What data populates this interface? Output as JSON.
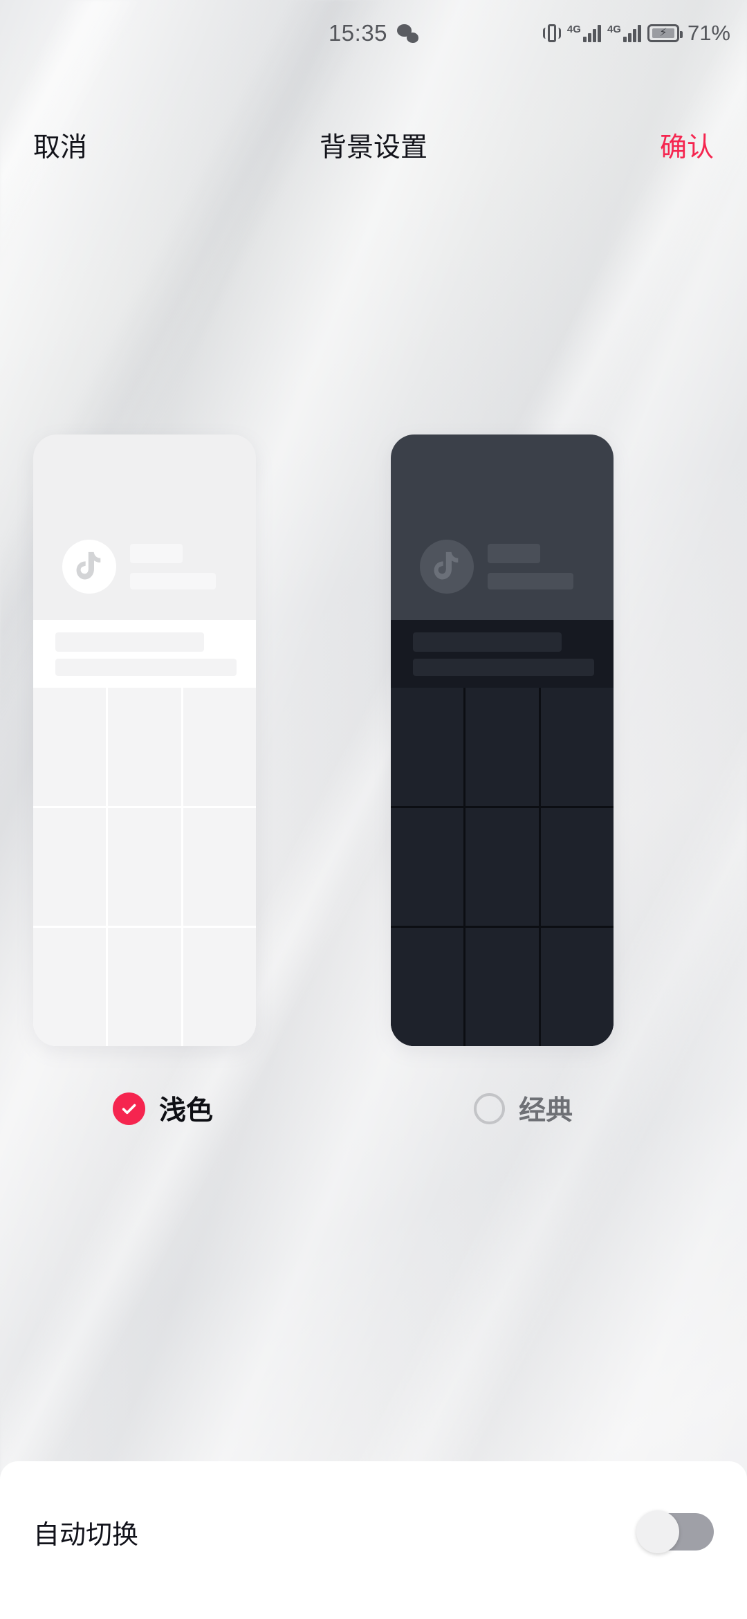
{
  "statusbar": {
    "time": "15:35",
    "wechat_icon": "wechat-icon",
    "vibrate_icon": "vibrate-icon",
    "sim1_network": "4G",
    "sim2_network": "4G",
    "battery_icon": "battery-charging-icon",
    "battery_percent": "71%"
  },
  "navbar": {
    "cancel_label": "取消",
    "title": "背景设置",
    "confirm_label": "确认",
    "confirm_color": "#f5254f"
  },
  "previews": {
    "light": {
      "name": "浅色",
      "logo_icon": "douyin-note-icon",
      "card_bg": "#f0f0f1",
      "band_bg": "#ffffff",
      "tile_bg": "#f4f4f5"
    },
    "dark": {
      "name": "经典",
      "logo_icon": "douyin-note-icon",
      "card_bg": "#3b4049",
      "band_bg": "#161921",
      "tile_bg": "#1e222b"
    }
  },
  "options": [
    {
      "label": "浅色",
      "selected": true,
      "icon": "check-circle-filled-icon",
      "accent": "#f5254f"
    },
    {
      "label": "经典",
      "selected": false,
      "icon": "radio-empty-icon",
      "accent": "#c3c4c7"
    }
  ],
  "bottom_sheet": {
    "auto_switch_label": "自动切换",
    "auto_switch_state": "off",
    "track_color": "#9fa0a7",
    "knob_color": "#f0f0f1"
  }
}
